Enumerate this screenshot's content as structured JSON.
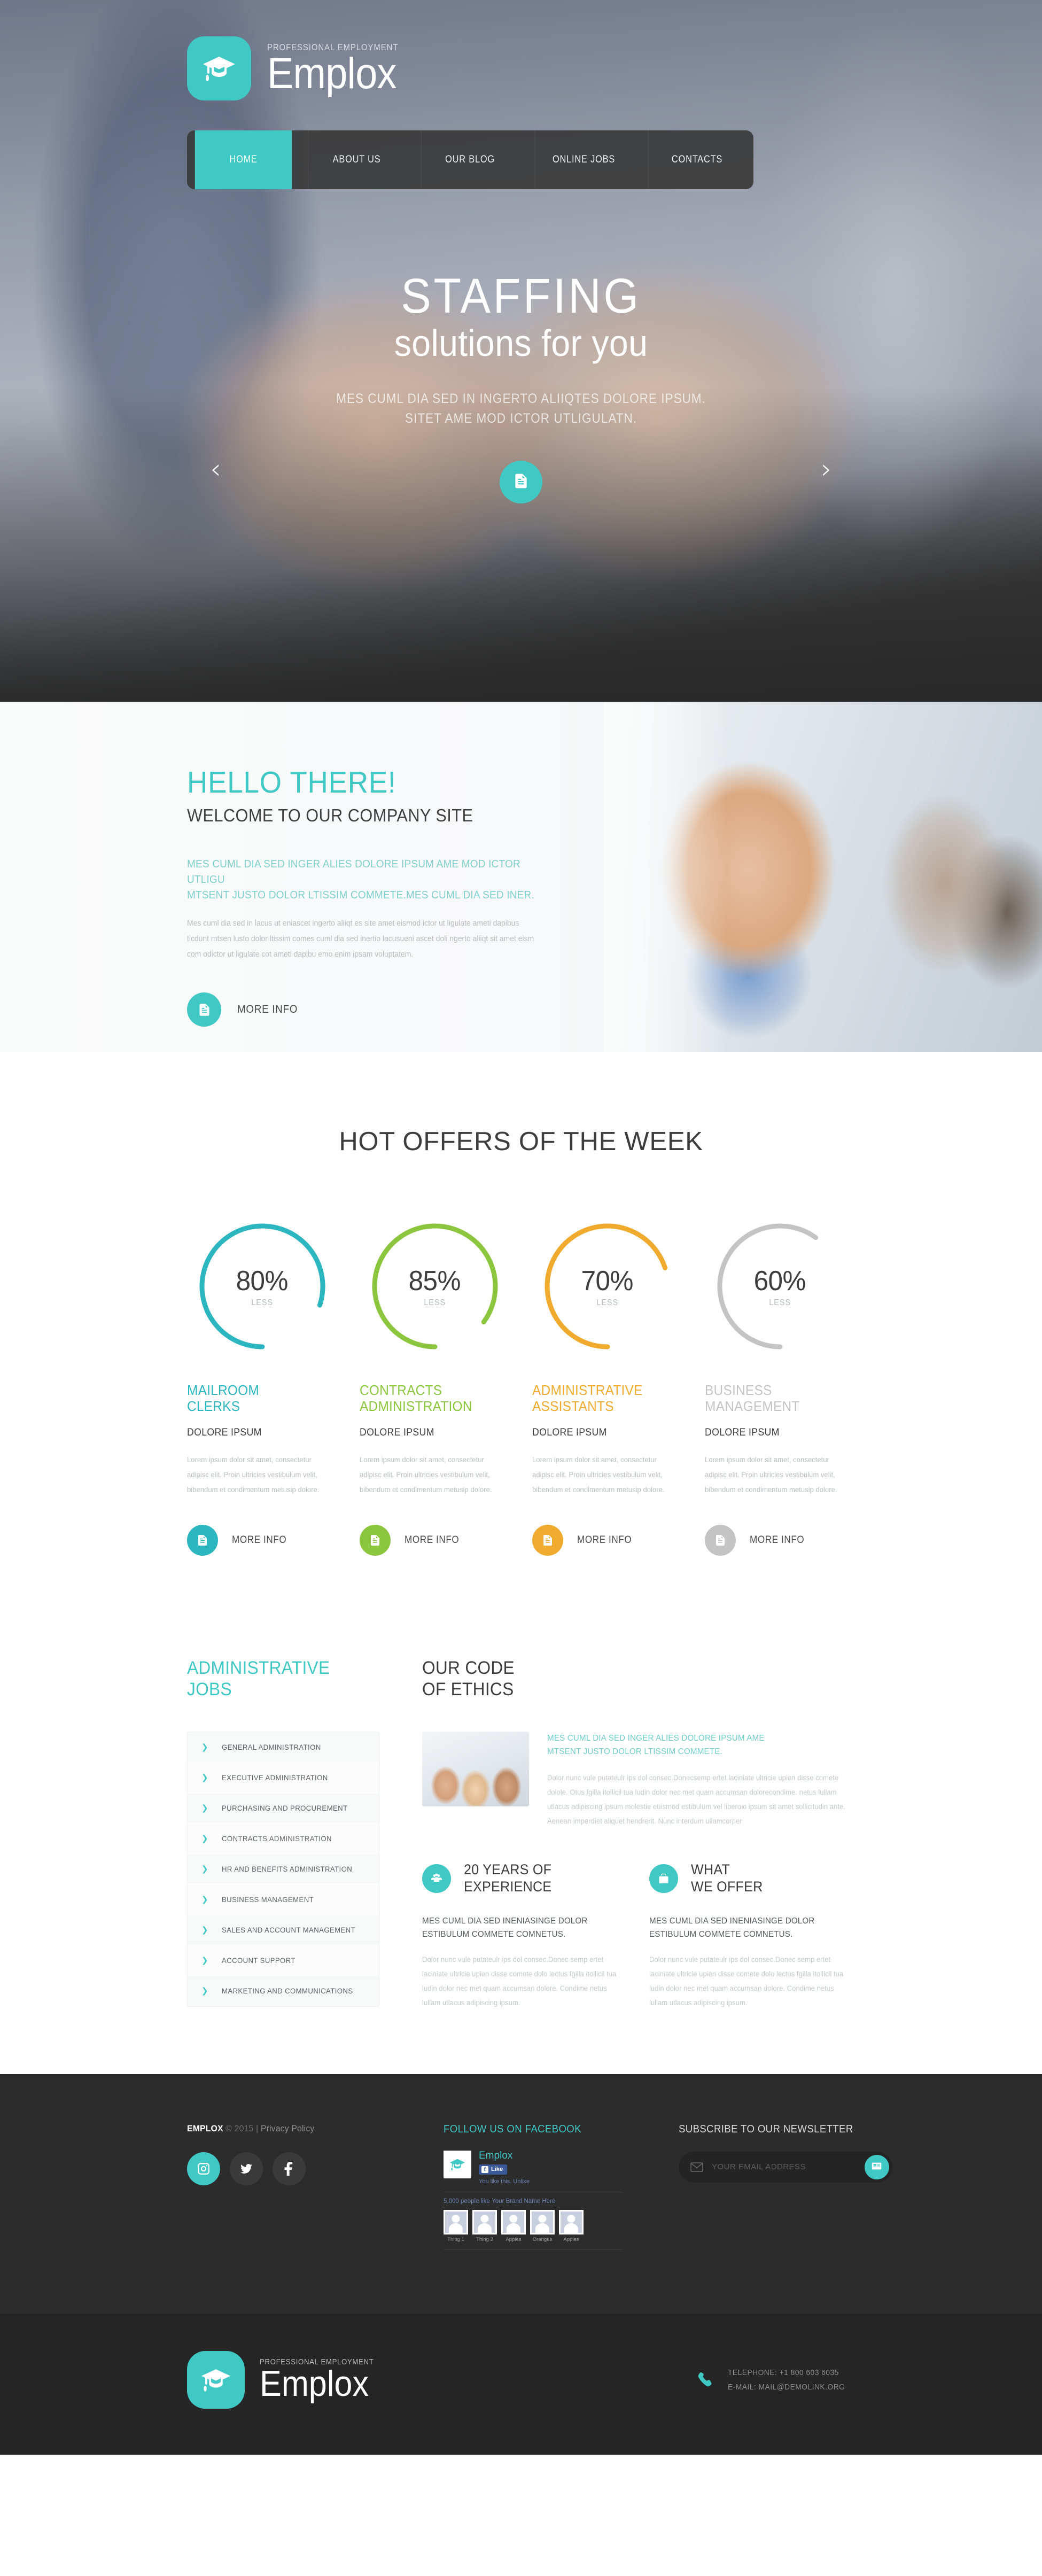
{
  "brand": {
    "tagline": "PROFESSIONAL EMPLOYMENT",
    "name": "Emplox",
    "badge_icon": "graduation-cap-icon",
    "accent_color": "#3fc8c4"
  },
  "nav": {
    "items": [
      {
        "label": "HOME",
        "active": true
      },
      {
        "label": "ABOUT US",
        "active": false
      },
      {
        "label": "OUR BLOG",
        "active": false
      },
      {
        "label": "ONLINE JOBS",
        "active": false
      },
      {
        "label": "CONTACTS",
        "active": false
      }
    ]
  },
  "hero": {
    "title": "STAFFING",
    "subtitle": "solutions for you",
    "description": "MES CUML DIA SED IN INGERTO ALIIQTES DOLORE IPSUM. SITET AME MOD ICTOR UTLIGULATN.",
    "cta_icon": "document-icon",
    "prev_icon": "chevron-left-icon",
    "prev_label": "‹",
    "next_icon": "chevron-right-icon",
    "next_label": "›"
  },
  "hello": {
    "heading": "HELLO THERE!",
    "subheading": "WELCOME TO OUR COMPANY SITE",
    "lead": "MES CUML DIA SED INGER ALIES DOLORE IPSUM AME MOD ICTOR UTLIGU MTSENT JUSTO DOLOR LTISSIM COMMETE.MES CUML DIA SED INER.",
    "body": "Mes cuml dia sed in lacus ut eniascet ingerto aliiqt es site amet eismod ictor ut ligulate ameti dapibus ticdunt mtsen lusto dolor ltissim comes cuml dia sed inertio lacusueni ascet doli ngerto aliiqt sit amet eism com odictor ut ligulate cot ameti dapibu emo enim ipsam voluptatem.",
    "button_label": "MORE INFO",
    "button_icon": "document-icon"
  },
  "offers": {
    "title": "HOT OFFERS OF THE WEEK",
    "less_label": "LESS",
    "button_label": "MORE INFO",
    "button_icon": "document-icon",
    "items": [
      {
        "percent": "80%",
        "value": 80,
        "color": "#2cb6bf",
        "name": "MAILROOM CLERKS",
        "subtitle": "DOLORE IPSUM",
        "text": "Lorem ipsum dolor sit amet, consectetur adipisc elit. Proin ultricies vestibulum velit, bibendum et condimentum metusip dolore."
      },
      {
        "percent": "85%",
        "value": 85,
        "color": "#8cc63e",
        "name": "CONTRACTS ADMINISTRATION",
        "subtitle": "DOLORE IPSUM",
        "text": "Lorem ipsum dolor sit amet, consectetur adipisc elit. Proin ultricies vestibulum velit, bibendum et condimentum metusip dolore."
      },
      {
        "percent": "70%",
        "value": 70,
        "color": "#f0ab2e",
        "name": "ADMINISTRATIVE ASSISTANTS",
        "subtitle": "DOLORE IPSUM",
        "text": "Lorem ipsum dolor sit amet, consectetur adipisc elit. Proin ultricies vestibulum velit, bibendum et condimentum metusip dolore."
      },
      {
        "percent": "60%",
        "value": 60,
        "color": "#c4c4c4",
        "name": "BUSINESS MANAGEMENT",
        "subtitle": "DOLORE IPSUM",
        "text": "Lorem ipsum dolor sit amet, consectetur adipisc elit. Proin ultricies vestibulum velit, bibendum et condimentum metusip dolore."
      }
    ]
  },
  "jobs": {
    "heading": "ADMINISTRATIVE JOBS",
    "chevron_icon": "chevron-right-icon",
    "items": [
      "GENERAL ADMINISTRATION",
      "EXECUTIVE ADMINISTRATION",
      "PURCHASING AND PROCUREMENT",
      "CONTRACTS ADMINISTRATION",
      "HR AND BENEFITS ADMINISTRATION",
      "BUSINESS MANAGEMENT",
      "SALES AND ACCOUNT MANAGEMENT",
      "ACCOUNT SUPPORT",
      "MARKETING AND COMMUNICATIONS"
    ]
  },
  "ethics": {
    "heading": "OUR CODE OF ETHICS",
    "lead": "MES CUML DIA SED INGER ALIES DOLORE IPSUM AME MTSENT JUSTO DOLOR LTISSIM COMMETE.",
    "text": "Dolor nunc vule putateulr ips dol consec.Donecsemp ertet laciniate ultricie upien disse comete dolole. Otus fgilla itollicil tua ludin dolor nec met quam accumsan dolorecondime. netus lullam utlacus adipiscing ipsum molestie euismod estibulum vel liberoю ipsum sit amet sollicitudin ante. Aenean imperdiet aliquet hendrerit. Nunc interdum ullamcorper"
  },
  "features": [
    {
      "icon": "group-people-icon",
      "title": "20 YEARS OF EXPERIENCE",
      "lead": "MES CUML DIA SED INENIASINGE DOLOR ESTIBULUM COMMETE COMNETUS.",
      "text": "Dolor nunc vule putateulr ips dol consec.Donec semp ertet laciniate ultricie upien disse comete dolo lectus fgilla itollicil tua ludin dolor nec met quam accumsan dolore. Condime netus lullam utlacus adipiscing ipsum."
    },
    {
      "icon": "briefcase-icon",
      "title": "WHAT WE OFFER",
      "lead": "MES CUML DIA SED INENIASINGE DOLOR ESTIBULUM COMMETE COMNETUS.",
      "text": "Dolor nunc vule putateulr ips dol consec.Donec semp ertet laciniate ultricie upien disse comete dolo lectus fgilla itollicil tua ludin dolor nec met quam accumsan dolore. Condime netus lullam utlacus adipiscing ipsum."
    }
  ],
  "footer": {
    "brand_name": "EMPLOX",
    "copyright": "© 2015",
    "separator": "|",
    "privacy_label": "Privacy Policy",
    "socials": [
      {
        "icon": "instagram-icon",
        "active": true
      },
      {
        "icon": "twitter-icon",
        "active": false
      },
      {
        "icon": "facebook-icon",
        "active": false
      }
    ],
    "facebook": {
      "heading": "FOLLOW US ON FACEBOOK",
      "page_name": "Emplox",
      "page_icon": "graduation-cap-icon",
      "like_label": "Like",
      "like_icon": "facebook-f-icon",
      "you_like": "You like this.",
      "unlike_label": "Unlike",
      "count_text": "5,000 people like",
      "brand_link": "Your Brand Name Here",
      "friends": [
        "Thing 1",
        "Thing 2",
        "Apples",
        "Oranges",
        "Apples"
      ]
    },
    "newsletter": {
      "heading": "SUBSCRIBE TO OUR NEWSLETTER",
      "placeholder": "YOUR EMAIL ADDRESS",
      "value": "",
      "mail_icon": "envelope-icon",
      "submit_icon": "newspaper-icon"
    },
    "bottom": {
      "tagline": "PROFESSIONAL EMPLOYMENT",
      "name": "Emplox",
      "badge_icon": "graduation-cap-icon",
      "phone_icon": "phone-icon",
      "telephone": "TELEPHONE: +1 800 603 6035",
      "email": "E-MAIL: MAIL@DEMOLINK.ORG"
    }
  }
}
